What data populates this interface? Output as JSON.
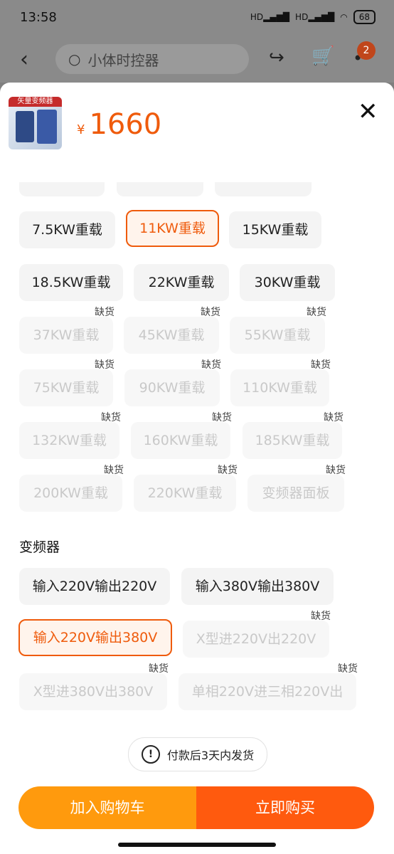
{
  "status_bar": {
    "time": "13:58",
    "signal_1": "HD",
    "signal_2": "HD",
    "battery": "68"
  },
  "app_bar": {
    "search_text": "小体时控器",
    "cart_badge": "2"
  },
  "sheet": {
    "price_currency": "¥",
    "price": "1660",
    "thumbnail_caption": "矢量变频器",
    "power_options": [
      {
        "label": "7.5KW重载",
        "state": "normal"
      },
      {
        "label": "11KW重载",
        "state": "selected"
      },
      {
        "label": "15KW重载",
        "state": "normal"
      },
      {
        "label": "18.5KW重载",
        "state": "normal"
      },
      {
        "label": "22KW重载",
        "state": "normal"
      },
      {
        "label": "30KW重载",
        "state": "normal"
      },
      {
        "label": "37KW重载",
        "state": "out_of_stock"
      },
      {
        "label": "45KW重载",
        "state": "out_of_stock"
      },
      {
        "label": "55KW重载",
        "state": "out_of_stock"
      },
      {
        "label": "75KW重载",
        "state": "out_of_stock"
      },
      {
        "label": "90KW重载",
        "state": "out_of_stock"
      },
      {
        "label": "110KW重载",
        "state": "out_of_stock"
      },
      {
        "label": "132KW重载",
        "state": "out_of_stock"
      },
      {
        "label": "160KW重载",
        "state": "out_of_stock"
      },
      {
        "label": "185KW重载",
        "state": "out_of_stock"
      },
      {
        "label": "200KW重载",
        "state": "out_of_stock"
      },
      {
        "label": "220KW重载",
        "state": "out_of_stock"
      },
      {
        "label": "变频器面板",
        "state": "out_of_stock"
      }
    ],
    "out_of_stock_label": "缺货",
    "section_title": "变频器",
    "inverter_options": [
      {
        "label": "输入220V输出220V",
        "state": "normal"
      },
      {
        "label": "输入380V输出380V",
        "state": "normal"
      },
      {
        "label": "输入220V输出380V",
        "state": "selected"
      },
      {
        "label": "X型进220V出220V",
        "state": "out_of_stock"
      },
      {
        "label": "X型进380V出380V",
        "state": "out_of_stock"
      },
      {
        "label": "单相220V进三相220V出",
        "state": "out_of_stock"
      }
    ],
    "notice": "付款后3天内发货",
    "add_to_cart": "加入购物车",
    "buy_now": "立即购买"
  }
}
